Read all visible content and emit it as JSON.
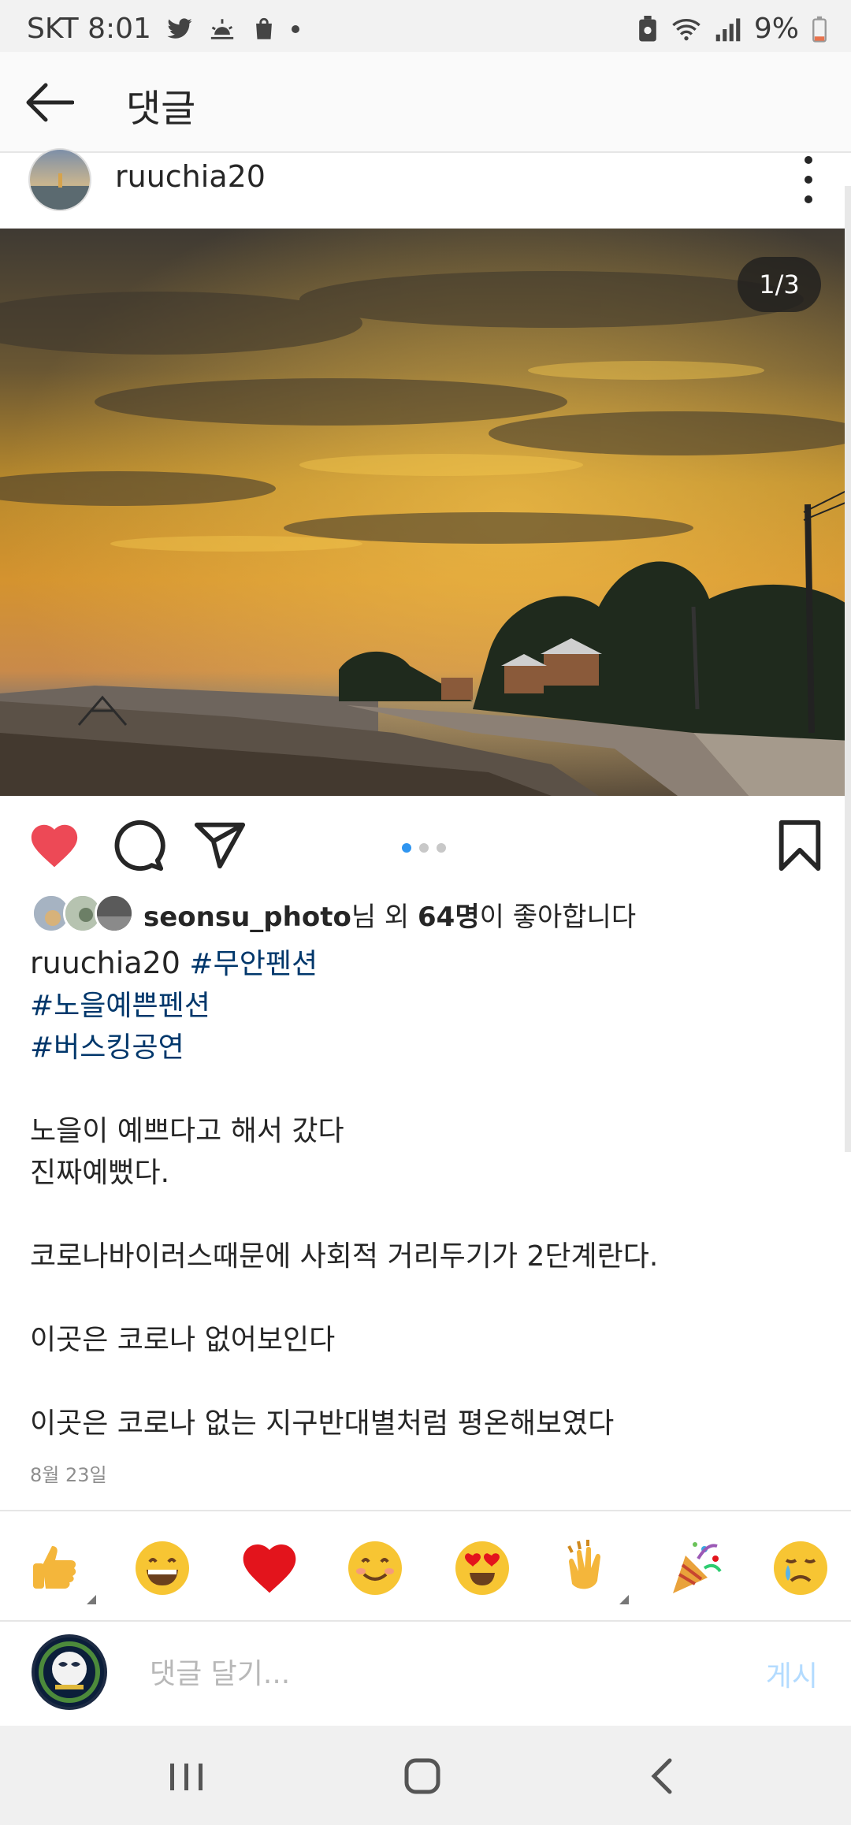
{
  "status_bar": {
    "carrier_time": "SKT 8:01",
    "battery": "9%"
  },
  "header": {
    "title": "댓글"
  },
  "post": {
    "username": "ruuchia20",
    "image_counter": "1/3",
    "likes": {
      "user": "seonsu_photo",
      "mid": "님 외 ",
      "count": "64명",
      "suffix": "이 좋아합니다"
    },
    "caption": {
      "username": "ruuchia20",
      "tags": [
        "#무안펜션",
        "#노을예쁜펜션",
        "#버스킹공연"
      ],
      "lines": [
        "노을이 예쁘다고 해서 갔다",
        "진짜예뻤다.",
        "코로나바이러스때문에 사회적 거리두기가 2단계란다.",
        "이곳은 코로나 없어보인다",
        "이곳은 코로나 없는 지구반대별처럼 평온해보였다"
      ]
    },
    "date": "8월 23일"
  },
  "emoji_bar": [
    "thumbs-up",
    "grinning",
    "heart",
    "smiling",
    "heart-eyes",
    "clapping",
    "party-popper",
    "crying"
  ],
  "comment": {
    "placeholder": "댓글 달기...",
    "post_label": "게시"
  },
  "colors": {
    "like_red": "#ed4956",
    "tag_blue": "#00376b",
    "post_disabled": "#b3dbff",
    "pager_active": "#2f95f0"
  }
}
